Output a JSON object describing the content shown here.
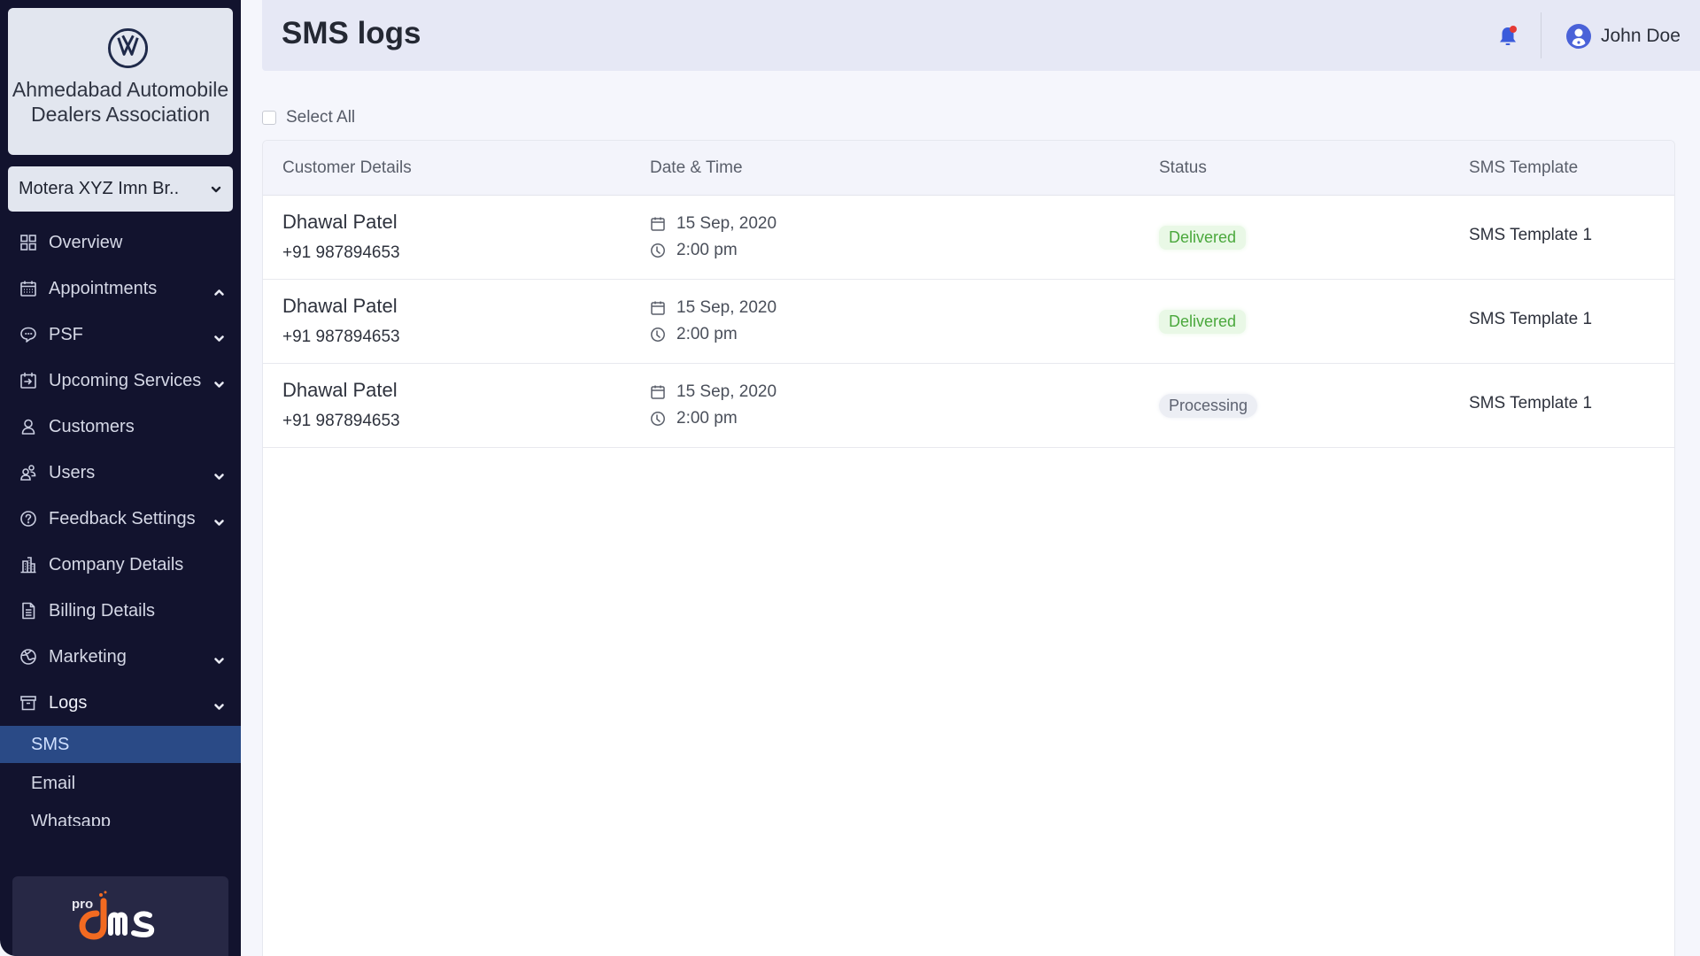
{
  "sidebar": {
    "org_name": "Ahmedabad Automobile Dealers Association",
    "org_logo_icon": "vw-logo-icon",
    "branch_select": {
      "value": "Motera XYZ Imn Br.."
    },
    "nav": [
      {
        "label": "Overview",
        "icon": "grid-icon",
        "chevron": null
      },
      {
        "label": "Appointments",
        "icon": "calendar-icon",
        "chevron": "up"
      },
      {
        "label": "PSF",
        "icon": "chat-bubble-icon",
        "chevron": "down"
      },
      {
        "label": "Upcoming Services",
        "icon": "calendar-arrow-icon",
        "chevron": "down"
      },
      {
        "label": "Customers",
        "icon": "user-icon",
        "chevron": null
      },
      {
        "label": "Users",
        "icon": "users-icon",
        "chevron": "down"
      },
      {
        "label": "Feedback Settings",
        "icon": "question-circle-icon",
        "chevron": "down"
      },
      {
        "label": "Company Details",
        "icon": "building-icon",
        "chevron": null
      },
      {
        "label": "Billing Details",
        "icon": "document-icon",
        "chevron": null
      },
      {
        "label": "Marketing",
        "icon": "globe-icon",
        "chevron": "down"
      },
      {
        "label": "Logs",
        "icon": "archive-box-icon",
        "chevron": "down"
      }
    ],
    "logs_sub": [
      {
        "label": "SMS",
        "active": true
      },
      {
        "label": "Email",
        "active": false
      },
      {
        "label": "Whatsapp",
        "active": false
      }
    ],
    "brand": {
      "prefix": "pro",
      "name": "dms"
    }
  },
  "header": {
    "title": "SMS logs",
    "notification_icon": "bell-icon",
    "user_name": "John Doe"
  },
  "select_all": {
    "label": "Select All",
    "checked": false
  },
  "table": {
    "columns": [
      "Customer Details",
      "Date & Time",
      "Status",
      "SMS Template"
    ],
    "rows": [
      {
        "name": "Dhawal Patel",
        "phone": "+91 987894653",
        "date": "15 Sep, 2020",
        "time": "2:00 pm",
        "status": "Delivered",
        "template": "SMS Template 1"
      },
      {
        "name": "Dhawal Patel",
        "phone": "+91 987894653",
        "date": "15 Sep, 2020",
        "time": "2:00 pm",
        "status": "Delivered",
        "template": "SMS Template 1"
      },
      {
        "name": "Dhawal Patel",
        "phone": "+91 987894653",
        "date": "15 Sep, 2020",
        "time": "2:00 pm",
        "status": "Processing",
        "template": "SMS Template 1"
      }
    ]
  },
  "colors": {
    "sidebar_bg": "#12132e",
    "active_item_bg": "#2a4a86",
    "header_bg": "#e6e8f5",
    "delivered_text": "#4aa83c",
    "delivered_bg": "#e9f8e6",
    "processing_bg": "#eceef4",
    "bell": "#3b5bdb",
    "bell_badge": "#e53935",
    "brand_orange": "#f26a21"
  }
}
